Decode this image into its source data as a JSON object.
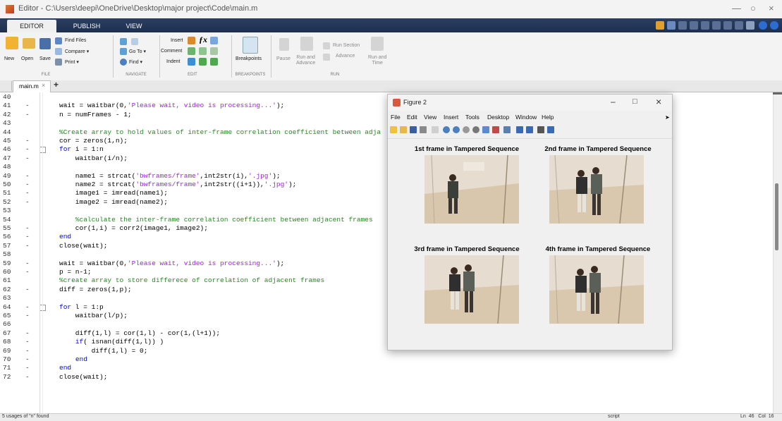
{
  "titlebar": {
    "title": "Editor - C:\\Users\\deepi\\OneDrive\\Desktop\\major project\\Code\\main.m"
  },
  "tabs": [
    "EDITOR",
    "PUBLISH",
    "VIEW"
  ],
  "ribbon": {
    "file": {
      "new": "New",
      "open": "Open",
      "save": "Save",
      "find_files": "Find Files",
      "compare": "Compare ▾",
      "print": "Print ▾",
      "label": "FILE"
    },
    "navigate": {
      "goto": "Go To ▾",
      "find": "Find ▾",
      "label": "NAVIGATE"
    },
    "edit": {
      "insert": "Insert",
      "comment": "Comment",
      "indent": "Indent",
      "label": "EDIT"
    },
    "breakpoints": {
      "button": "Breakpoints",
      "label": "BREAKPOINTS"
    },
    "run": {
      "pause": "Pause",
      "run_advance": "Run and\nAdvance",
      "run_section": "Run Section",
      "advance": "Advance",
      "run_time": "Run and\nTime",
      "label": "RUN"
    }
  },
  "editor_tab": {
    "file": "main.m",
    "close": "×",
    "add": "+"
  },
  "code_lines": [
    {
      "n": "40",
      "d": "",
      "t": ""
    },
    {
      "n": "41",
      "d": "-",
      "t": "wait = waitbar(0,'Please wait, video is processing...');"
    },
    {
      "n": "42",
      "d": "-",
      "t": "n = numFrames - 1;"
    },
    {
      "n": "43",
      "d": "",
      "t": ""
    },
    {
      "n": "44",
      "d": "",
      "t": "%Create array to hold values of inter-frame correlation coefficient between adja"
    },
    {
      "n": "45",
      "d": "-",
      "t": "cor = zeros(1,n);"
    },
    {
      "n": "46",
      "d": "-",
      "t": "for i = 1:n"
    },
    {
      "n": "47",
      "d": "-",
      "t": "    waitbar(i/n);"
    },
    {
      "n": "48",
      "d": "",
      "t": ""
    },
    {
      "n": "49",
      "d": "-",
      "t": "    name1 = strcat('bwframes/frame',int2str(i),'.jpg');"
    },
    {
      "n": "50",
      "d": "-",
      "t": "    name2 = strcat('bwframes/frame',int2str((i+1)),'.jpg');"
    },
    {
      "n": "51",
      "d": "-",
      "t": "    image1 = imread(name1);"
    },
    {
      "n": "52",
      "d": "-",
      "t": "    image2 = imread(name2);"
    },
    {
      "n": "53",
      "d": "",
      "t": ""
    },
    {
      "n": "54",
      "d": "",
      "t": "    %calculate the inter-frame correlation coefficient between adjacent frames"
    },
    {
      "n": "55",
      "d": "-",
      "t": "    cor(1,i) = corr2(image1, image2);"
    },
    {
      "n": "56",
      "d": "-",
      "t": "end"
    },
    {
      "n": "57",
      "d": "-",
      "t": "close(wait);"
    },
    {
      "n": "58",
      "d": "",
      "t": ""
    },
    {
      "n": "59",
      "d": "-",
      "t": "wait = waitbar(0,'Please wait, video is processing...');"
    },
    {
      "n": "60",
      "d": "-",
      "t": "p = n-1;"
    },
    {
      "n": "61",
      "d": "",
      "t": "%create array to store differece of correlation of adjacent frames"
    },
    {
      "n": "62",
      "d": "-",
      "t": "diff = zeros(1,p);"
    },
    {
      "n": "63",
      "d": "",
      "t": ""
    },
    {
      "n": "64",
      "d": "-",
      "t": "for l = 1:p"
    },
    {
      "n": "65",
      "d": "-",
      "t": "    waitbar(l/p);"
    },
    {
      "n": "66",
      "d": "",
      "t": ""
    },
    {
      "n": "67",
      "d": "-",
      "t": "    diff(1,l) = cor(1,l) - cor(1,(l+1));"
    },
    {
      "n": "68",
      "d": "-",
      "t": "    if( isnan(diff(1,l)) )"
    },
    {
      "n": "69",
      "d": "-",
      "t": "        diff(1,l) = 0;"
    },
    {
      "n": "70",
      "d": "-",
      "t": "    end"
    },
    {
      "n": "71",
      "d": "-",
      "t": "end"
    },
    {
      "n": "72",
      "d": "-",
      "t": "close(wait);"
    }
  ],
  "status": {
    "left": "5 usages of \"n\" found",
    "mode": "script",
    "position": "Ln  46   Col  16"
  },
  "figure": {
    "title": "Figure 2",
    "menu": [
      "File",
      "Edit",
      "View",
      "Insert",
      "Tools",
      "Desktop",
      "Window",
      "Help"
    ],
    "panels": [
      "1st frame in Tampered Sequence",
      "2nd frame in Tampered Sequence",
      "3rd frame in Tampered Sequence",
      "4th frame in Tampered Sequence"
    ]
  },
  "colors": {
    "tabstrip": "#1e2f4f",
    "comment": "#228b22",
    "keyword": "#0000ff",
    "string": "#a020f0"
  }
}
